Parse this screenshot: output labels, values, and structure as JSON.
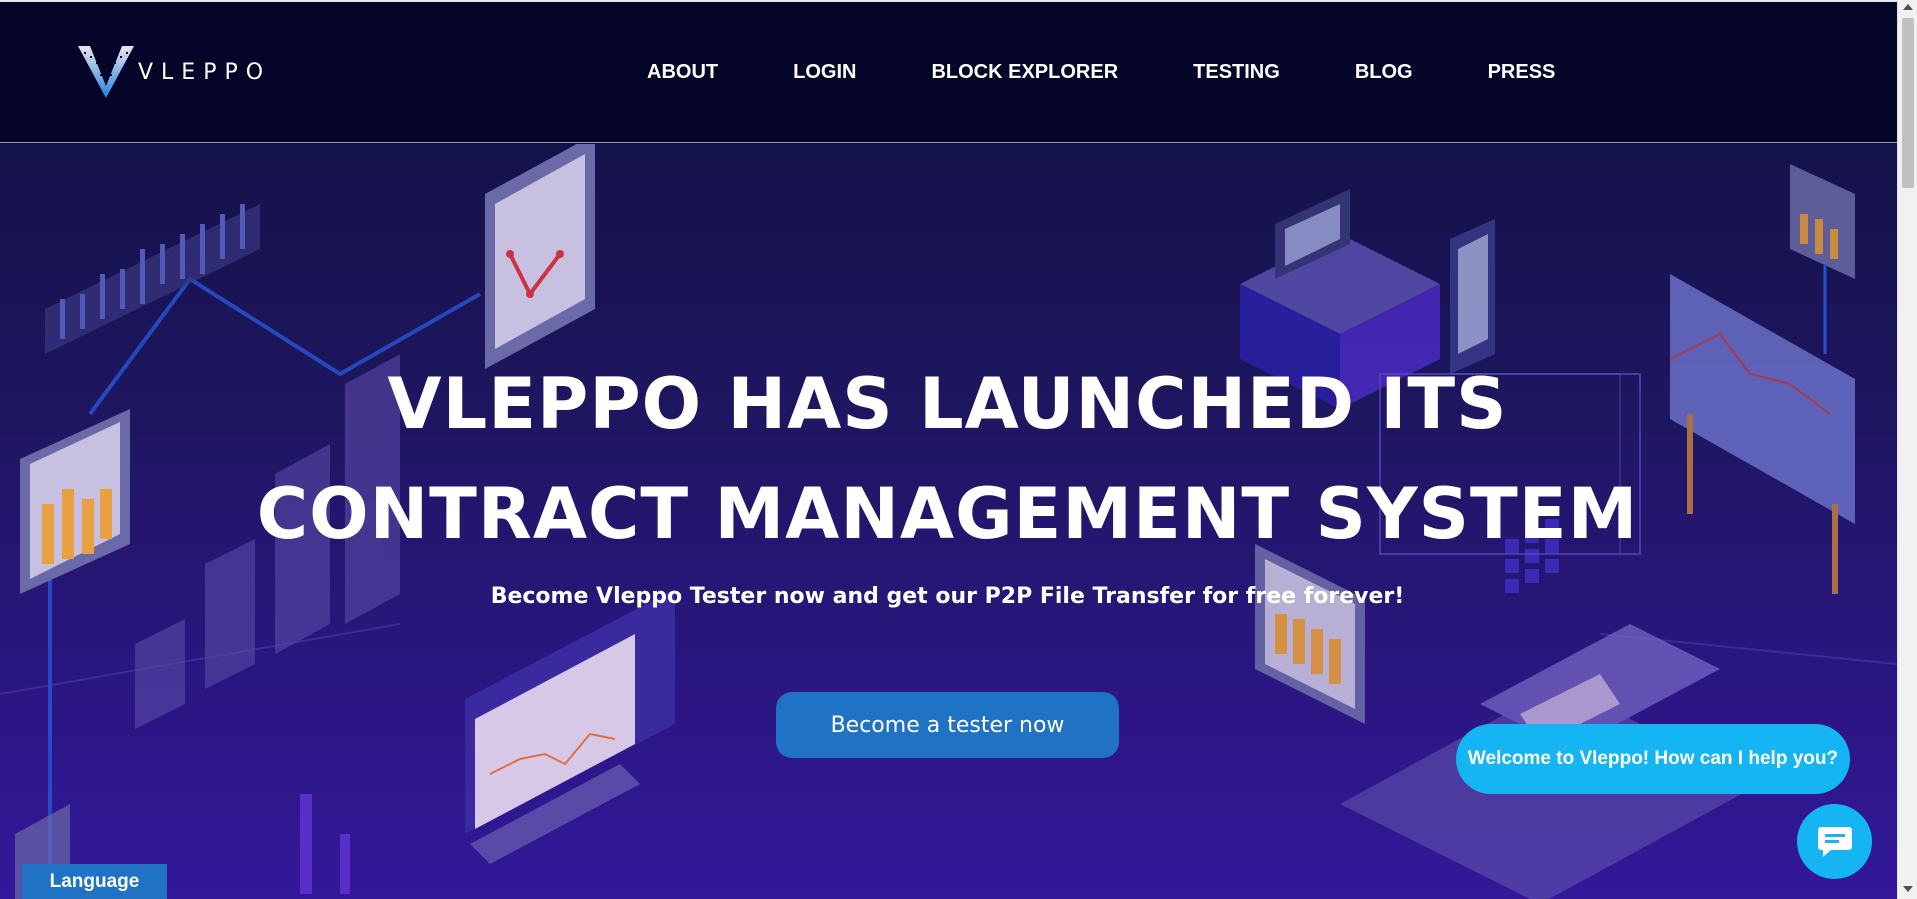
{
  "brand": {
    "name": "VLEPPO"
  },
  "nav": {
    "items": [
      {
        "label": "ABOUT"
      },
      {
        "label": "LOGIN"
      },
      {
        "label": "BLOCK EXPLORER"
      },
      {
        "label": "TESTING"
      },
      {
        "label": "BLOG"
      },
      {
        "label": "PRESS"
      }
    ]
  },
  "hero": {
    "title_line1": "VLEPPO HAS LAUNCHED ITS",
    "title_line2": "CONTRACT MANAGEMENT SYSTEM",
    "subtitle": "Become Vleppo Tester now and get our P2P File Transfer for free forever!",
    "cta_label": "Become a tester now"
  },
  "chat": {
    "greeting": "Welcome to Vleppo! How can I help you?",
    "icon": "chat-icon"
  },
  "language": {
    "label": "Language"
  },
  "colors": {
    "header_bg": "#05052a",
    "accent_blue": "#1f72c4",
    "chat_cyan": "#14b5f2"
  }
}
